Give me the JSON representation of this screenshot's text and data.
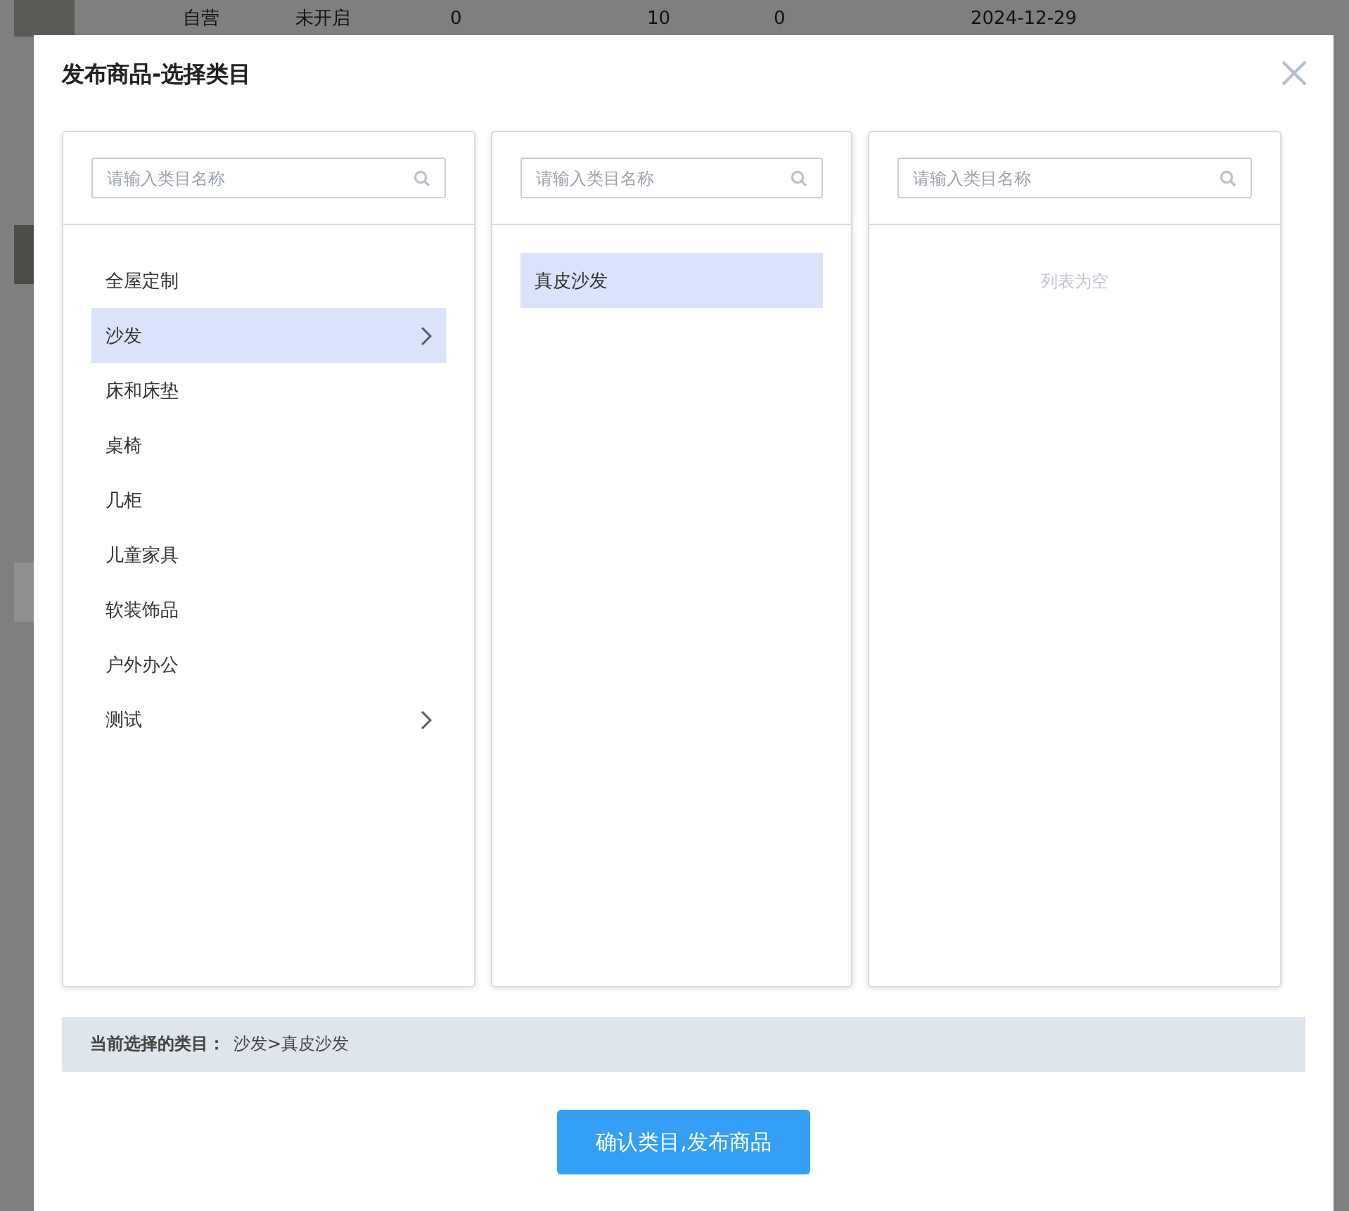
{
  "background_table": {
    "rows": [
      {
        "cells": [
          "自营",
          "未开启",
          "0",
          "10",
          "0",
          "2024-12-29"
        ]
      }
    ]
  },
  "dialog": {
    "title": "发布商品-选择类目"
  },
  "columns": [
    {
      "search": {
        "placeholder": "请输入类目名称"
      },
      "items": [
        {
          "label": "全屋定制",
          "selected": false,
          "has_children": false
        },
        {
          "label": "沙发",
          "selected": true,
          "has_children": true
        },
        {
          "label": "床和床垫",
          "selected": false,
          "has_children": false
        },
        {
          "label": "桌椅",
          "selected": false,
          "has_children": false
        },
        {
          "label": "几柜",
          "selected": false,
          "has_children": false
        },
        {
          "label": "儿童家具",
          "selected": false,
          "has_children": false
        },
        {
          "label": "软装饰品",
          "selected": false,
          "has_children": false
        },
        {
          "label": "户外办公",
          "selected": false,
          "has_children": false
        },
        {
          "label": "测试",
          "selected": false,
          "has_children": true
        }
      ]
    },
    {
      "search": {
        "placeholder": "请输入类目名称"
      },
      "items": [
        {
          "label": "真皮沙发",
          "selected": true,
          "has_children": false
        }
      ]
    },
    {
      "search": {
        "placeholder": "请输入类目名称"
      },
      "empty_text": "列表为空"
    }
  ],
  "current_selection": {
    "label": "当前选择的类目：",
    "value": "沙发>真皮沙发"
  },
  "confirm_button": {
    "label": "确认类目,发布商品"
  }
}
